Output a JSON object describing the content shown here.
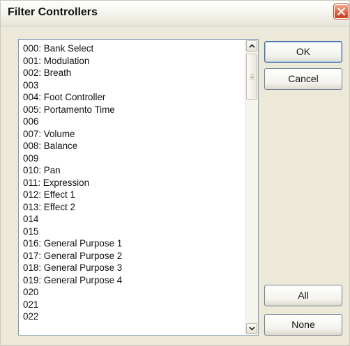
{
  "dialog": {
    "title": "Filter Controllers",
    "close_icon": "close-x-icon"
  },
  "controllers": [
    "000: Bank Select",
    "001: Modulation",
    "002: Breath",
    "003",
    "004: Foot Controller",
    "005: Portamento Time",
    "006",
    "007: Volume",
    "008: Balance",
    "009",
    "010: Pan",
    "011: Expression",
    "012: Effect 1",
    "013: Effect 2",
    "014",
    "015",
    "016: General Purpose 1",
    "017: General Purpose 2",
    "018: General Purpose 3",
    "019: General Purpose 4",
    "020",
    "021",
    "022"
  ],
  "buttons": {
    "ok": "OK",
    "cancel": "Cancel",
    "all": "All",
    "none": "None"
  },
  "colors": {
    "dialog_bg": "#ece9d8",
    "close_button": "#e2603f",
    "list_border": "#7f9db9"
  }
}
